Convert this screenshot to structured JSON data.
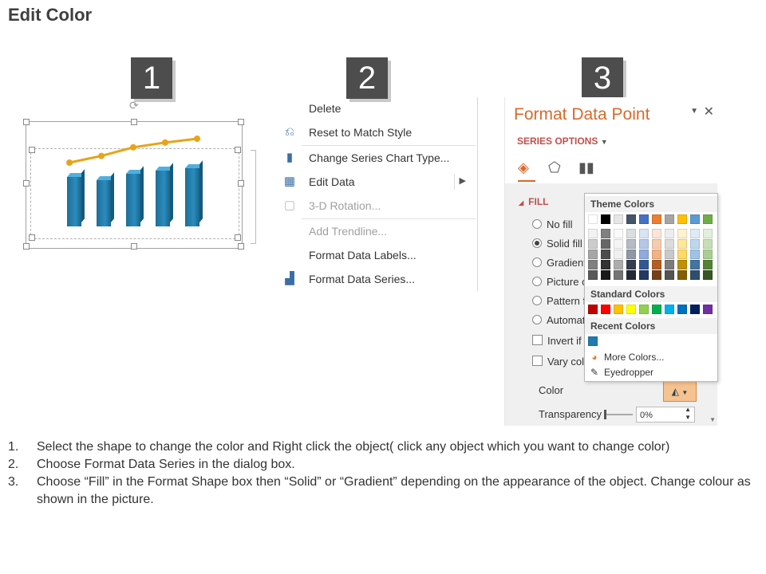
{
  "title": "Edit Color",
  "steps": [
    "1",
    "2",
    "3"
  ],
  "context_menu": {
    "items": [
      {
        "label": "Delete",
        "icon": "delete-icon",
        "disabled": false
      },
      {
        "label": "Reset to Match Style",
        "icon": "reset-style-icon",
        "disabled": false
      },
      {
        "label": "Change Series Chart Type...",
        "icon": "chart-type-icon",
        "disabled": false
      },
      {
        "label": "Edit Data",
        "icon": "edit-data-icon",
        "disabled": false,
        "submenu": true
      },
      {
        "label": "3-D Rotation...",
        "icon": "rotation-icon",
        "disabled": true
      },
      {
        "label": "Add Trendline...",
        "icon": "",
        "disabled": true
      },
      {
        "label": "Format Data Labels...",
        "icon": "",
        "disabled": false
      },
      {
        "label": "Format Data Series...",
        "icon": "format-series-icon",
        "disabled": false
      }
    ]
  },
  "format_panel": {
    "title": "Format Data Point",
    "series_options": "SERIES OPTIONS",
    "fill_header": "FILL",
    "options": [
      {
        "label": "No fill",
        "selected": false
      },
      {
        "label": "Solid fill",
        "selected": true
      },
      {
        "label": "Gradient",
        "selected": false
      },
      {
        "label": "Picture o",
        "selected": false
      },
      {
        "label": "Pattern f",
        "selected": false
      },
      {
        "label": "Automat",
        "selected": false
      }
    ],
    "checkboxes": [
      "Invert if r",
      "Vary colo"
    ],
    "color_label": "Color",
    "transparency_label": "Transparency",
    "transparency_value": "0%"
  },
  "color_popup": {
    "theme_colors_label": "Theme Colors",
    "standard_colors_label": "Standard Colors",
    "recent_colors_label": "Recent Colors",
    "more_colors": "More Colors...",
    "eyedropper": "Eyedropper",
    "theme_top": [
      "#ffffff",
      "#000000",
      "#e7e6e6",
      "#44546a",
      "#4472c4",
      "#ed7d31",
      "#a5a5a5",
      "#ffc000",
      "#5b9bd5",
      "#70ad47"
    ],
    "standard": [
      "#c00000",
      "#ff0000",
      "#ffc000",
      "#ffff00",
      "#92d050",
      "#00b050",
      "#00b0f0",
      "#0070c0",
      "#002060",
      "#7030a0"
    ],
    "recent": [
      "#1f7bb0"
    ]
  },
  "chart_preview": {
    "bars": [
      62,
      58,
      66,
      70,
      73
    ],
    "line": [
      0.0,
      0.14,
      0.32,
      0.42,
      0.5
    ]
  },
  "instructions": [
    {
      "num": "1.",
      "text": "Select the shape to change the color and Right click the object( click any object which you want to change color)"
    },
    {
      "num": "2.",
      "text": "Choose Format Data Series in the dialog box."
    },
    {
      "num": "3.",
      "text": "Choose “Fill” in the Format Shape box then “Solid” or “Gradient” depending on the appearance of the object. Change colour as shown in the picture."
    }
  ]
}
